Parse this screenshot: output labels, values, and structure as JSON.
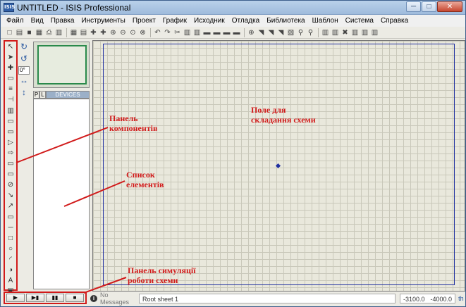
{
  "window": {
    "icon_text": "ISIS",
    "title": "UNTITLED - ISIS Professional",
    "controls": [
      "─",
      "□",
      "✕"
    ]
  },
  "menu": [
    "Файл",
    "Вид",
    "Правка",
    "Инструменты",
    "Проект",
    "График",
    "Исходник",
    "Отладка",
    "Библиотека",
    "Шаблон",
    "Система",
    "Справка"
  ],
  "toolbar": {
    "icons": [
      "□",
      "▤",
      "■",
      "▦",
      "⎙",
      "▥",
      "▦",
      "▤",
      "✚",
      "✚",
      "⊕",
      "⊖",
      "⊙",
      "⊗",
      "↶",
      "↷",
      "✂",
      "▥",
      "▥",
      "▬",
      "▬",
      "▬",
      "▬",
      "⊕",
      "◥",
      "◥",
      "◥",
      "▧",
      "⚲",
      "⚲",
      "▥",
      "▥",
      "✖",
      "▥",
      "▥",
      "▥"
    ]
  },
  "component_bar": {
    "icons": [
      "↖",
      "➤",
      "✚",
      "▭",
      "≡",
      "⊣",
      "▥",
      "▭",
      "▭",
      "▷",
      "⇨",
      "▭",
      "▭",
      "⊘",
      "↘",
      "↗",
      "▭",
      "─",
      "□",
      "○",
      "◜",
      "◑",
      "A",
      "▣",
      "✚"
    ]
  },
  "rotate": {
    "clockwise": "↻",
    "counterclockwise": "↺",
    "angle": "0°",
    "mirror_h": "↔",
    "mirror_v": "↕"
  },
  "devices": {
    "tab_p": "P",
    "tab_l": "L",
    "title": "DEVICES"
  },
  "sim": {
    "buttons": [
      "▶",
      "▶▮",
      "▮▮",
      "■"
    ]
  },
  "status": {
    "messages": "No Messages",
    "sheet": "Root sheet 1",
    "x": "-3100.0",
    "y": "-4000.0",
    "unit": "th"
  },
  "annotations": {
    "components": "Панель\nкомпонентів",
    "elements": "Список\nелементів",
    "canvas": "Поле для\nскладання схеми",
    "simulation": "Панель симуляції\nроботи схеми"
  }
}
